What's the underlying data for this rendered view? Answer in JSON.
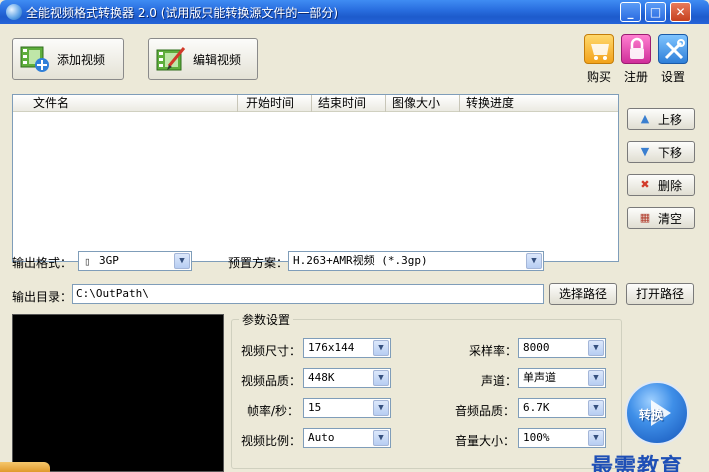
{
  "window": {
    "title": "全能视频格式转换器 2.0 (试用版只能转换源文件的一部分)",
    "min_symbol": "_",
    "max_symbol": "□",
    "close_symbol": "✕"
  },
  "toolbar": {
    "add_video": "添加视频",
    "edit_video": "编辑视频",
    "buy": "购买",
    "register": "注册",
    "settings": "设置"
  },
  "file_list": {
    "columns": [
      "文件名",
      "开始时间",
      "结束时间",
      "图像大小",
      "转换进度"
    ],
    "rows": []
  },
  "side_buttons": {
    "move_up": "上移",
    "move_down": "下移",
    "delete": "删除",
    "clear": "清空"
  },
  "output": {
    "format_label": "输出格式：",
    "format_value": "3GP",
    "preset_label": "预置方案：",
    "preset_value": "H.263+AMR视频 (*.3gp)",
    "dir_label": "输出目录：",
    "dir_value": "C:\\OutPath\\",
    "choose_path": "选择路径",
    "open_path": "打开路径"
  },
  "params": {
    "title": "参数设置",
    "video_size_label": "视频尺寸：",
    "video_size": "176x144",
    "video_quality_label": "视频品质：",
    "video_quality": "448K",
    "frame_rate_label": "帧率/秒：",
    "frame_rate": "15",
    "aspect_label": "视频比例：",
    "aspect": "Auto",
    "sample_rate_label": "采样率：",
    "sample_rate": "8000",
    "channel_label": "声道：",
    "channel": "单声道",
    "audio_quality_label": "音频品质：",
    "audio_quality": "6.7K",
    "volume_label": "音量大小：",
    "volume": "100%"
  },
  "convert_label": "转换",
  "watermark": "最需教育",
  "colors": {
    "titlebar": "#2a6fe0",
    "window_bg": "#ece9d8",
    "convert_button": "#3f8fe8",
    "watermark": "#1e4fb6"
  }
}
